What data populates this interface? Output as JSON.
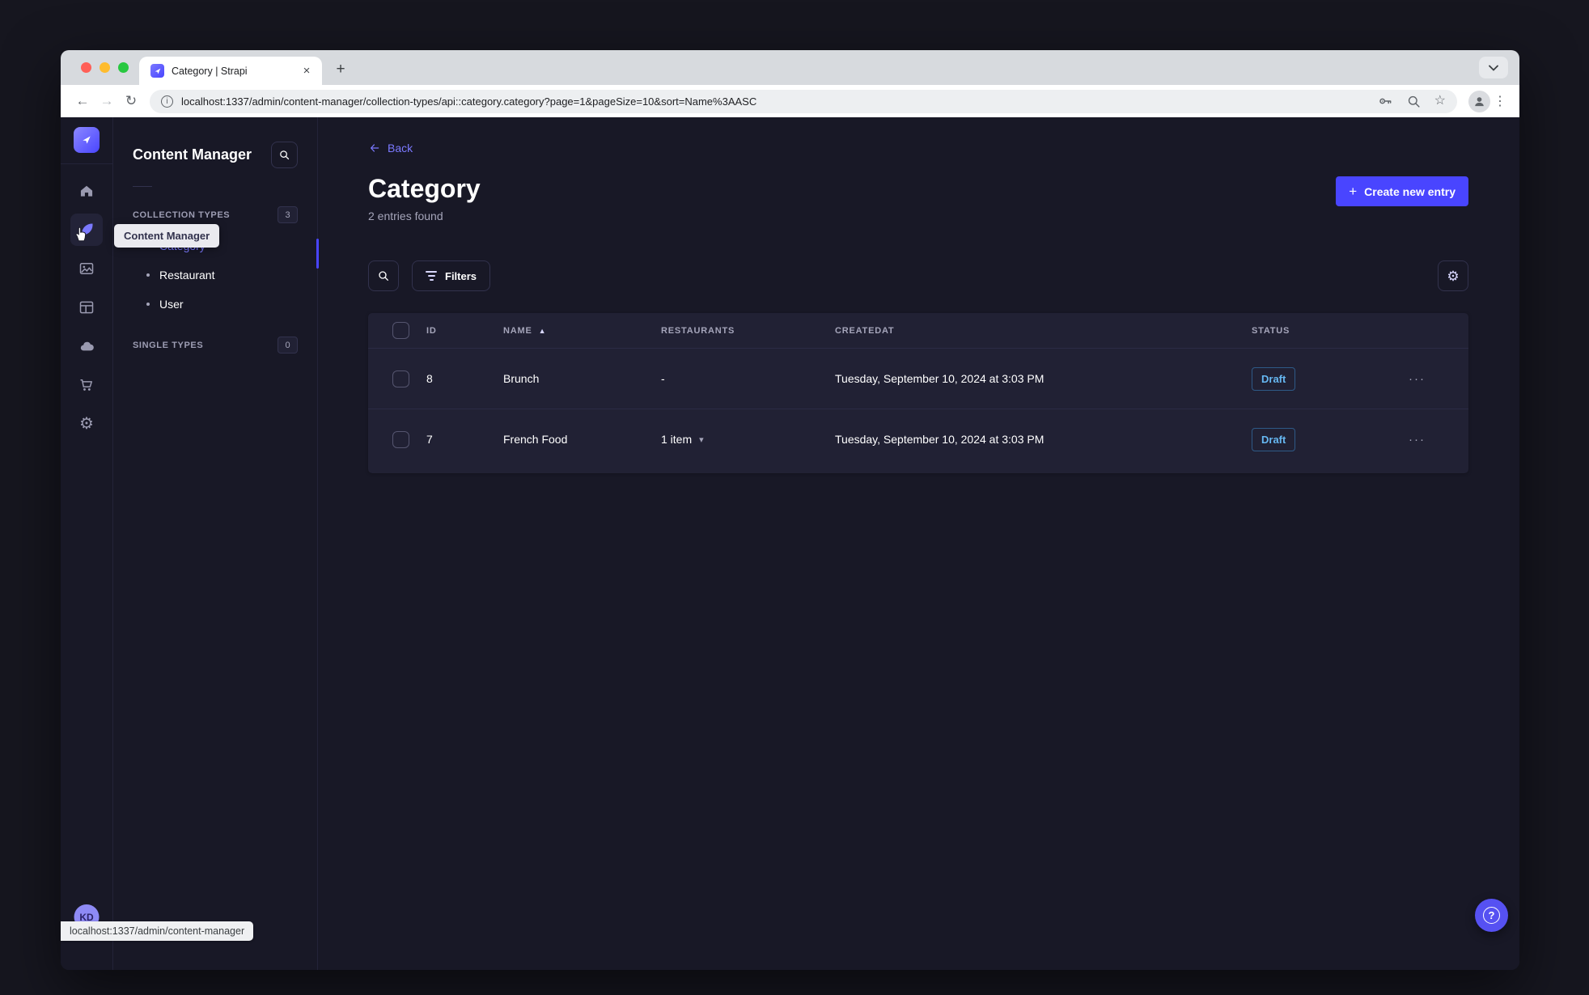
{
  "colors": {
    "accent": "#4945ff",
    "accent_light": "#7b79ff",
    "draft_blue": "#66b7f1"
  },
  "browser": {
    "tab_title": "Category | Strapi",
    "url": "localhost:1337/admin/content-manager/collection-types/api::category.category?page=1&pageSize=10&sort=Name%3AASC",
    "status_link": "localhost:1337/admin/content-manager"
  },
  "icons": {
    "close": "×",
    "new_tab": "+",
    "back": "←",
    "forward": "→",
    "reload": "↻",
    "kebab": "⋮",
    "star": "☆",
    "info": "i",
    "gear": "⚙",
    "sort_asc": "▲",
    "caret_down": "▾",
    "row_menu": "···",
    "help": "?",
    "plus": "+"
  },
  "nav": {
    "tooltip": "Content Manager",
    "avatar_initials": "KD"
  },
  "subnav": {
    "title": "Content Manager",
    "collection_types": {
      "label": "COLLECTION TYPES",
      "count": "3",
      "items": [
        {
          "label": "Category",
          "active": true
        },
        {
          "label": "Restaurant",
          "active": false
        },
        {
          "label": "User",
          "active": false
        }
      ]
    },
    "single_types": {
      "label": "SINGLE TYPES",
      "count": "0"
    }
  },
  "main": {
    "back_label": "Back",
    "title": "Category",
    "subtitle": "2 entries found",
    "create_button_label": "Create new entry",
    "filters_button_label": "Filters",
    "table": {
      "columns": [
        "ID",
        "NAME",
        "RESTAURANTS",
        "CREATEDAT",
        "STATUS"
      ],
      "sorted_column": "NAME",
      "rows": [
        {
          "id": "8",
          "name": "Brunch",
          "restaurants": "-",
          "createdAt": "Tuesday, September 10, 2024 at 3:03 PM",
          "status": "Draft"
        },
        {
          "id": "7",
          "name": "French Food",
          "restaurants": "1 item",
          "createdAt": "Tuesday, September 10, 2024 at 3:03 PM",
          "status": "Draft"
        }
      ]
    }
  }
}
